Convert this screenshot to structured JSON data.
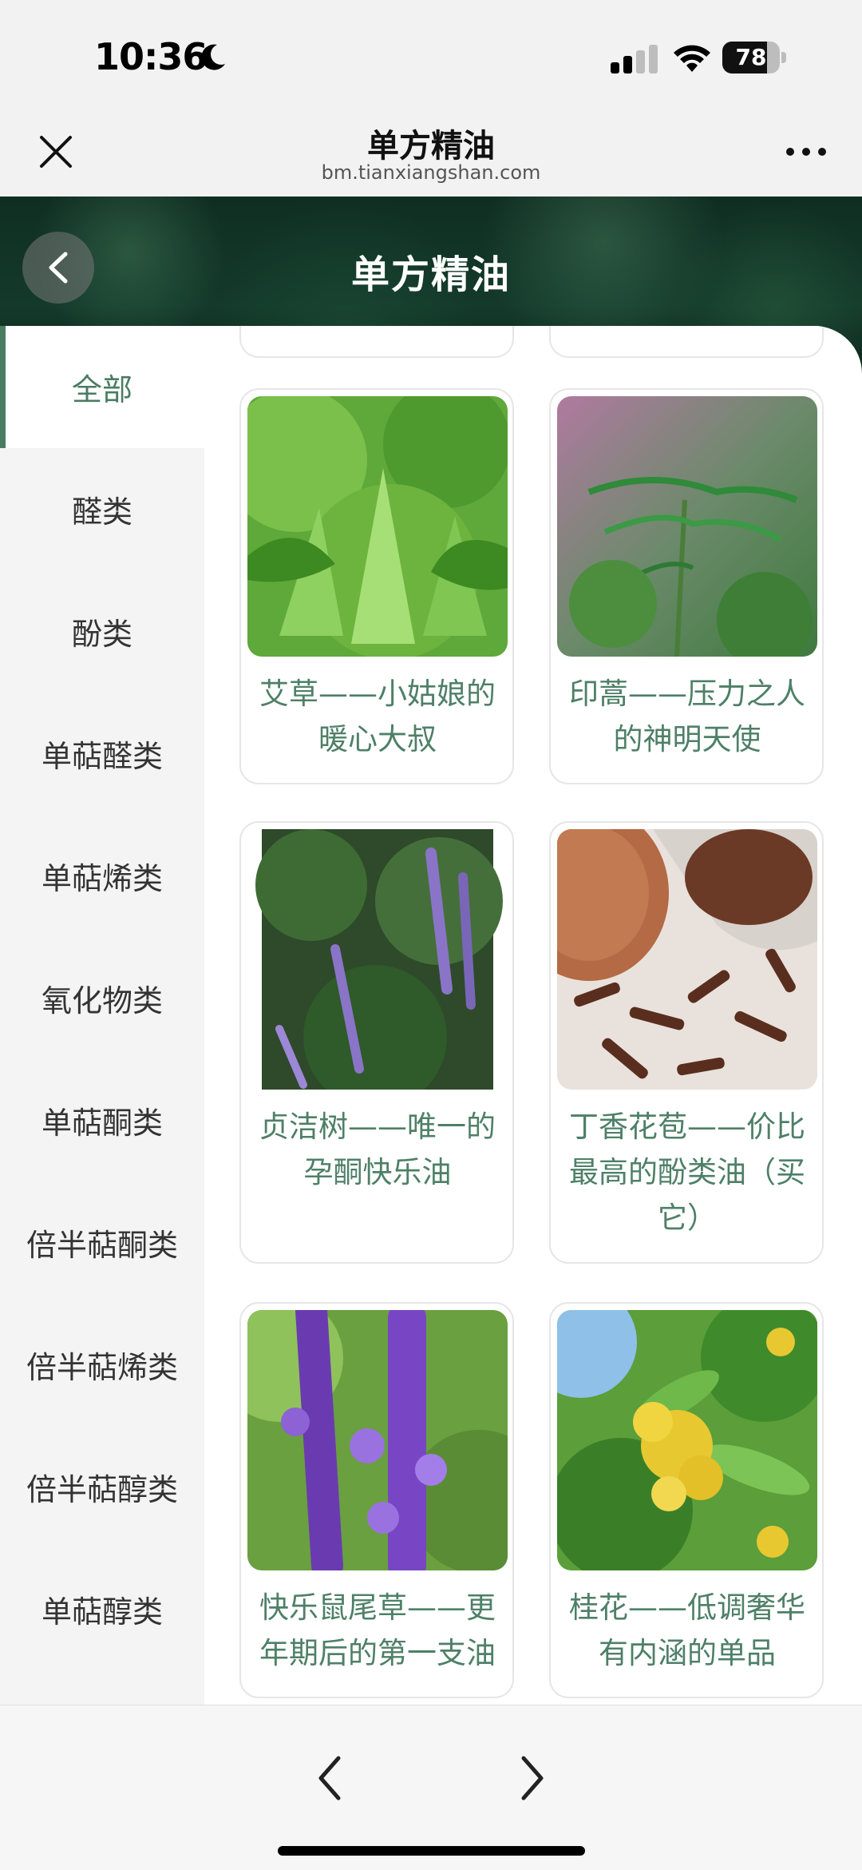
{
  "status_bar": {
    "time": "10:36",
    "battery": "78",
    "battery_level": 0.78
  },
  "navbar": {
    "title": "单方精油",
    "domain": "bm.tianxiangshan.com"
  },
  "banner": {
    "title": "单方精油"
  },
  "sidebar": {
    "items": [
      {
        "label": "全部",
        "active": true
      },
      {
        "label": "醛类"
      },
      {
        "label": "酚类"
      },
      {
        "label": "单萜醛类"
      },
      {
        "label": "单萜烯类"
      },
      {
        "label": "氧化物类"
      },
      {
        "label": "单萜酮类"
      },
      {
        "label": "倍半萜酮类"
      },
      {
        "label": "倍半萜烯类"
      },
      {
        "label": "倍半萜醇类"
      },
      {
        "label": "单萜醇类"
      }
    ]
  },
  "products": [
    {
      "title": "艾草——小姑娘的暖心大叔",
      "image": "mugwort-leaves"
    },
    {
      "title": "印蒿——压力之人的神明天使",
      "image": "davana-plant"
    },
    {
      "title": "贞洁树——唯一的孕酮快乐油",
      "image": "chaste-tree-flowers"
    },
    {
      "title": "丁香花苞——价比最高的酚类油（买它）",
      "image": "clove-buds"
    },
    {
      "title": "快乐鼠尾草——更年期后的第一支油",
      "image": "clary-sage-flowers"
    },
    {
      "title": "桂花——低调奢华有内涵的单品",
      "image": "osmanthus-flowers"
    }
  ],
  "colors": {
    "accent": "#4a7c62",
    "card_title": "#4e8067",
    "banner_dark": "#0f2e22"
  }
}
